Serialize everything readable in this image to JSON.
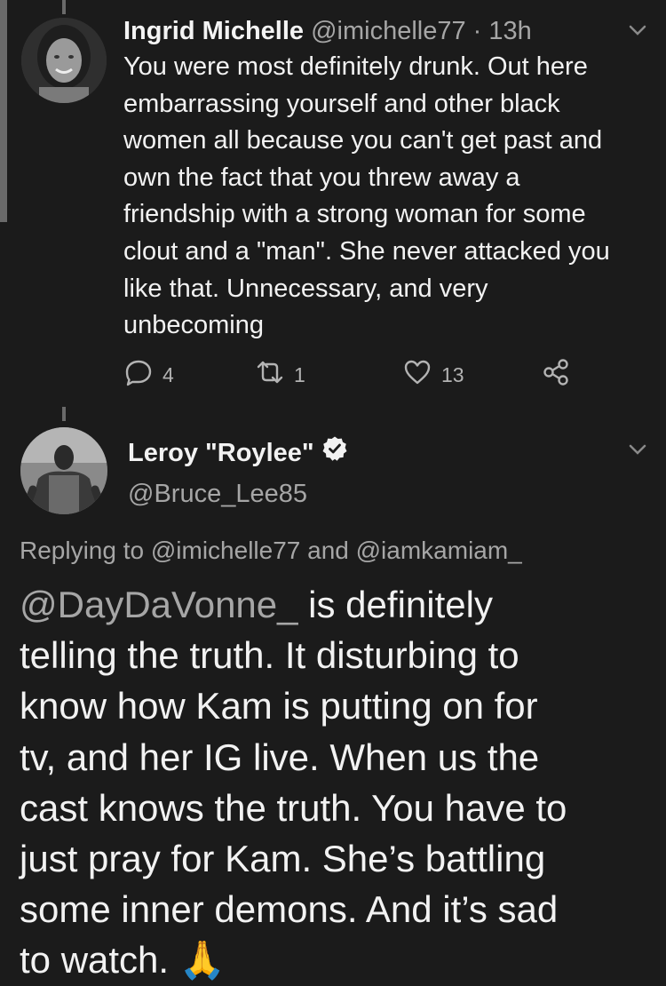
{
  "tweet1": {
    "display_name": "Ingrid Michelle",
    "handle": "@imichelle77",
    "separator": "·",
    "time": "13h",
    "body_lines": [
      "You were most definitely drunk. Out here",
      "embarrassing yourself and other black",
      "women all because you can't get past and",
      "own the fact that you threw away a",
      "friendship with a strong woman for some",
      "clout and a \"man\". She never attacked you",
      "like that. Unnecessary, and very",
      "unbecoming"
    ],
    "reply_count": "4",
    "retweet_count": "1",
    "like_count": "13"
  },
  "tweet2": {
    "display_name": "Leroy \"Roylee\"",
    "handle": "@Bruce_Lee85",
    "replying_to": "Replying to @imichelle77 and @iamkamiam_",
    "mention": "@DayDaVonne_",
    "first_line_rest": " is definitely",
    "body_lines": [
      "telling the truth. It disturbing to",
      "know how Kam is putting on for",
      "tv, and her IG live. When us the",
      "cast knows the truth. You have to",
      "just pray for Kam. She’s battling",
      "some inner demons. And it’s  sad",
      "to watch. 🙏"
    ]
  },
  "icons": [
    "reply-icon",
    "retweet-icon",
    "like-icon",
    "share-icon",
    "chevron-down-icon",
    "verified-icon"
  ],
  "colors": {
    "background": "#1b1b1b",
    "primary_text": "#f2f2f2",
    "secondary_text": "#a6a6a6",
    "icon": "#b3b3b3"
  }
}
